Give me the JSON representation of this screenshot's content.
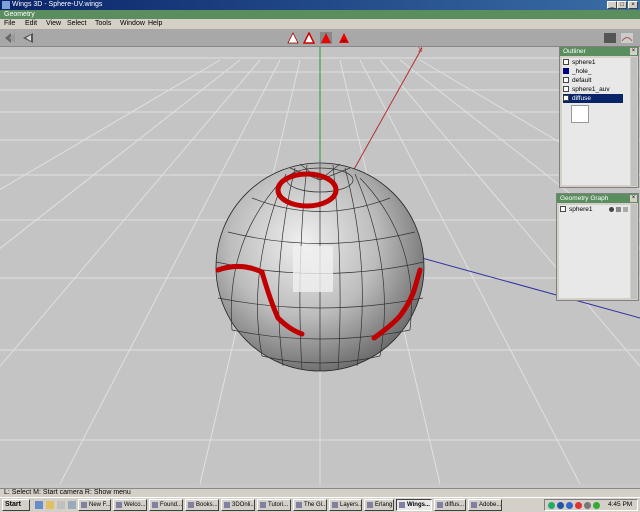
{
  "window": {
    "title": "Wings 3D - Sphere-UV.wings"
  },
  "geometry_header": "Geometry",
  "menubar": [
    "File",
    "Edit",
    "View",
    "Select",
    "Tools",
    "Window",
    "Help"
  ],
  "toolbar": {
    "left_icons": [
      "perspective-icon",
      "view-mode-icon"
    ],
    "center_icons": [
      "vertex-mode-icon",
      "edge-mode-icon",
      "face-mode-icon",
      "body-mode-icon"
    ],
    "right_icons": [
      "smooth-icon",
      "render-icon"
    ]
  },
  "outliner": {
    "title": "Outliner",
    "items": [
      {
        "label": "sphere1",
        "icon": "object-icon"
      },
      {
        "label": "_hole_",
        "icon": "material-icon",
        "color": "#000080"
      },
      {
        "label": "default",
        "icon": "material-icon"
      },
      {
        "label": "sphere1_auv",
        "icon": "image-icon"
      },
      {
        "label": "diffuse",
        "icon": "image-icon",
        "selected": true
      }
    ]
  },
  "geometry_graph": {
    "title": "Geometry Graph",
    "items": [
      {
        "label": "sphere1"
      }
    ]
  },
  "axes": {
    "x": "X"
  },
  "status": {
    "text": "L: Select    M: Start camera    R: Show menu"
  },
  "taskbar": {
    "start": "Start",
    "tasks": [
      "New F...",
      "Welco...",
      "Found...",
      "Books...",
      "3DOnli...",
      "Tutori...",
      "The Gl...",
      "Layers...",
      "Erlang",
      "Wings...",
      "diffus...",
      "Adobe..."
    ],
    "active_task": "Wings...",
    "clock": "4:45 PM"
  },
  "colors": {
    "title_bar": "#0a246a",
    "header_green": "#5b8e5f",
    "stroke_red": "#c00000",
    "selection": "#0a246a"
  }
}
